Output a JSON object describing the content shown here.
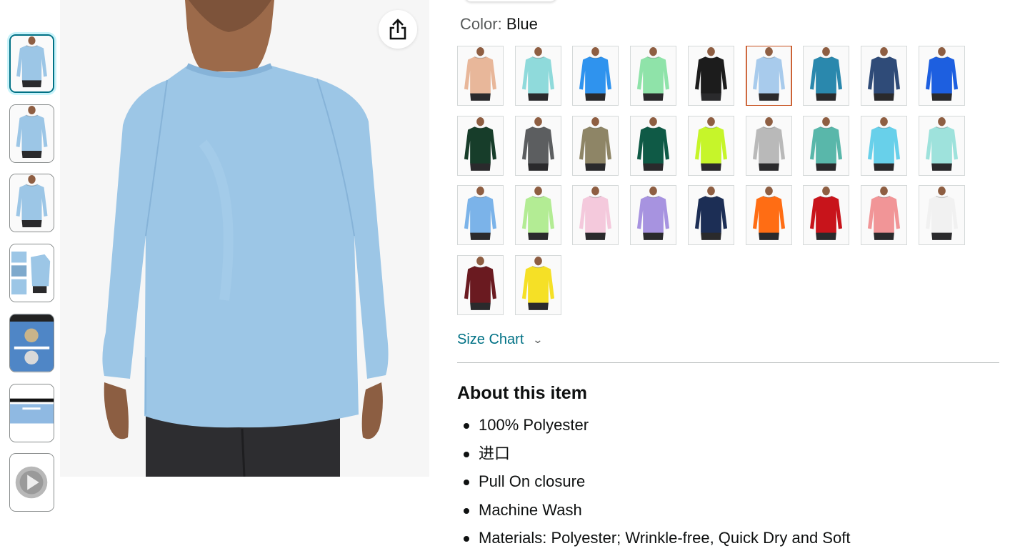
{
  "gallery": {
    "thumbnails": [
      {
        "kind": "shirt-front",
        "color": "#9cc6e6",
        "selected": true
      },
      {
        "kind": "shirt-front",
        "color": "#9cc6e6",
        "selected": false
      },
      {
        "kind": "shirt-side",
        "color": "#9cc6e6",
        "selected": false
      },
      {
        "kind": "detail-collage",
        "color": "#9cc6e6",
        "selected": false
      },
      {
        "kind": "fabric-closeup",
        "color": "#4f86c6",
        "selected": false
      },
      {
        "kind": "fabric-banner",
        "color": "#9cc6e6",
        "selected": false
      },
      {
        "kind": "video",
        "color": "#bbbbbb",
        "selected": false
      }
    ],
    "main_image": {
      "shirt_color": "#9cc6e6"
    },
    "share_icon": "share-icon"
  },
  "color_selector": {
    "label": "Color:",
    "selected_value": "Blue",
    "selected_index": 5,
    "swatches": [
      "#e8b79a",
      "#8fdadb",
      "#2f93ee",
      "#8fe3a9",
      "#1c1c1c",
      "#a8cbec",
      "#2a88ad",
      "#2f4b78",
      "#1d5fe0",
      "#173d2a",
      "#5c5e60",
      "#8e8566",
      "#0f5a46",
      "#c6f52a",
      "#b9b9b9",
      "#59b7aa",
      "#68d0ea",
      "#9ee2dc",
      "#7bb3e9",
      "#b3ec94",
      "#f4c9dc",
      "#a793e0",
      "#1c2e55",
      "#ff6d14",
      "#c8141b",
      "#f19597",
      "#f1f1f1",
      "#6a1a20",
      "#f5e026"
    ]
  },
  "size_chart": {
    "label": "Size Chart",
    "icon": "chevron-down-icon"
  },
  "about": {
    "title": "About this item",
    "bullets": [
      "100% Polyester",
      "进口",
      "Pull On closure",
      "Machine Wash",
      "Materials: Polyester; Wrinkle-free, Quick Dry and Soft"
    ]
  }
}
